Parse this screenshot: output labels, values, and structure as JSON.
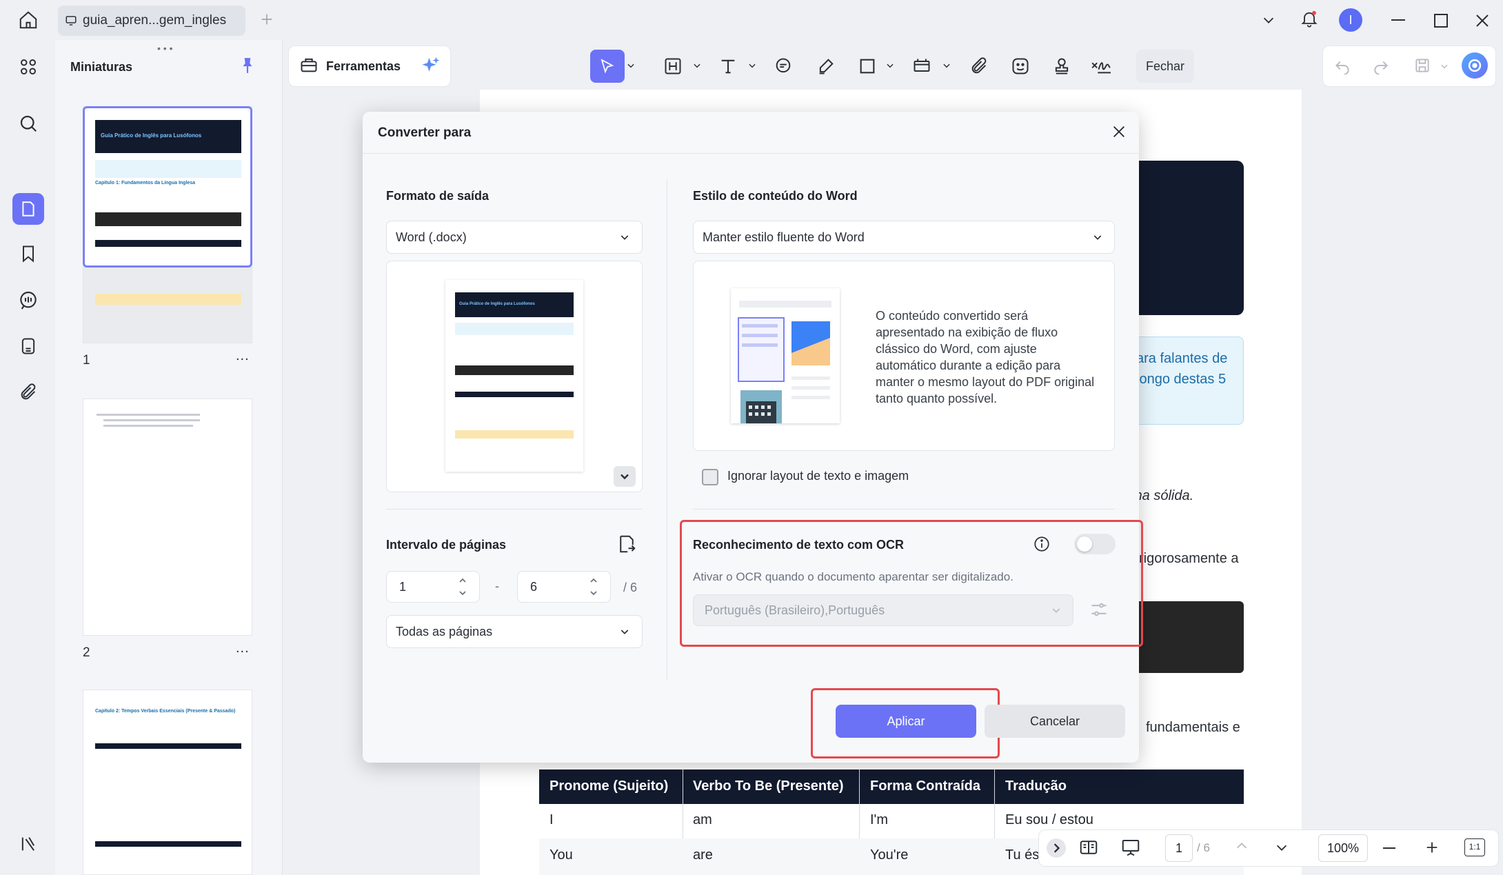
{
  "titlebar": {
    "tab_title": "guia_apren...gem_ingles",
    "avatar_letter": "I"
  },
  "thumbnails": {
    "title": "Miniaturas",
    "pages": [
      {
        "number": "1",
        "more": "..."
      },
      {
        "number": "2",
        "more": "..."
      }
    ],
    "page1_header": "Guia Prático de Inglês para Lusófonos",
    "page1_chapter": "Capítulo 1: Fundamentos da Língua Inglesa",
    "page3_chapter": "Capítulo 2: Tempos Verbais Essenciais (Presente & Passado)"
  },
  "toolbar": {
    "tools_label": "Ferramentas",
    "close_label": "Fechar"
  },
  "document": {
    "snippet1": "ara falantes de",
    "snippet2": "longo destas 5",
    "snippet3": "ma sólida.",
    "snippet4": "rigorosamente a",
    "snippet5": "fundamentais e",
    "table": {
      "headers": [
        "Pronome (Sujeito)",
        "Verbo To Be (Presente)",
        "Forma Contraída",
        "Tradução"
      ],
      "rows": [
        [
          "I",
          "am",
          "I'm",
          "Eu sou / estou"
        ],
        [
          "You",
          "are",
          "You're",
          "Tu és"
        ]
      ]
    }
  },
  "statusbar": {
    "current_page": "1",
    "total_pages": "/ 6",
    "zoom": "100%"
  },
  "dialog": {
    "title": "Converter para",
    "output_format": {
      "label": "Formato de saída",
      "value": "Word (.docx)"
    },
    "word_style": {
      "label": "Estilo de conteúdo do Word",
      "value": "Manter estilo fluente do Word",
      "description": "O conteúdo convertido será apresentado na exibição de fluxo clássico do Word, com ajuste automático durante a edição para manter o mesmo layout do PDF original tanto quanto possível."
    },
    "ignore_layout_label": "Ignorar layout de texto e imagem",
    "page_range": {
      "label": "Intervalo de páginas",
      "from": "1",
      "separator": "-",
      "to": "6",
      "total": "/ 6",
      "selection": "Todas as páginas"
    },
    "ocr": {
      "label": "Reconhecimento de texto com OCR",
      "hint": "Ativar o OCR quando o documento aparentar ser digitalizado.",
      "languages": "Português (Brasileiro),Português",
      "enabled": false
    },
    "apply_label": "Aplicar",
    "cancel_label": "Cancelar"
  },
  "colors": {
    "accent": "#6b72f6",
    "highlight_red": "#e5484d",
    "dark_navy": "#121a2e"
  }
}
